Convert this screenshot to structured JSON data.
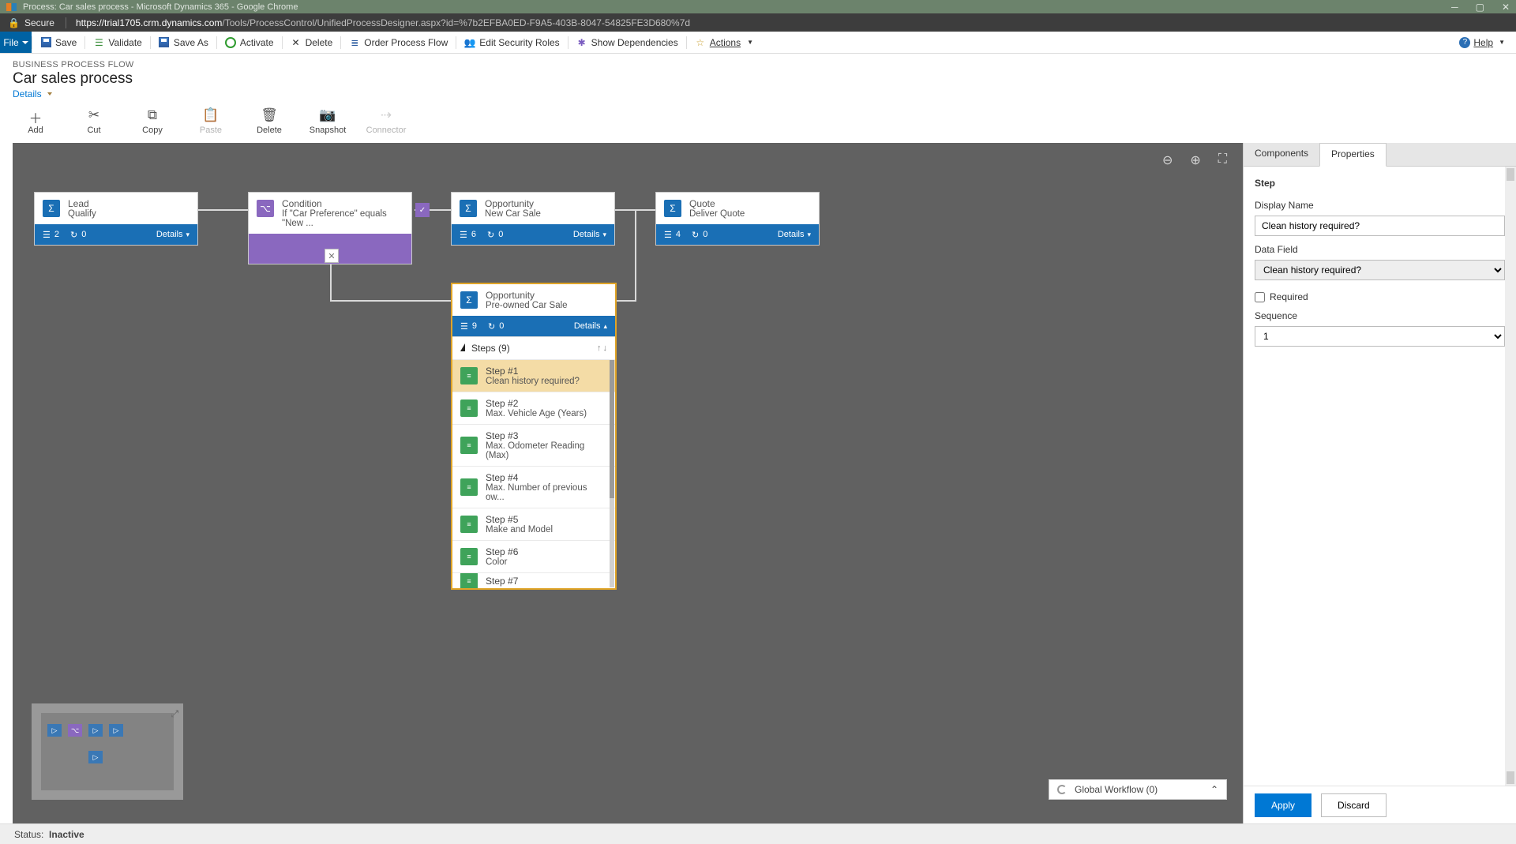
{
  "title_bar": "Process: Car sales process - Microsoft Dynamics 365 - Google Chrome",
  "url": {
    "secure": "Secure",
    "host": "https://trial1705.crm.dynamics.com",
    "path": "/Tools/ProcessControl/UnifiedProcessDesigner.aspx?id=%7b2EFBA0ED-F9A5-403B-8047-54825FE3D680%7d"
  },
  "cmd": {
    "file": "File",
    "save": "Save",
    "validate": "Validate",
    "saveas": "Save As",
    "activate": "Activate",
    "delete": "Delete",
    "order": "Order Process Flow",
    "editroles": "Edit Security Roles",
    "showdeps": "Show Dependencies",
    "actions": "Actions",
    "help": "Help"
  },
  "header": {
    "bpf": "BUSINESS PROCESS FLOW",
    "title": "Car sales process",
    "details": "Details"
  },
  "toolbar": {
    "add": "Add",
    "cut": "Cut",
    "copy": "Copy",
    "paste": "Paste",
    "delete": "Delete",
    "snapshot": "Snapshot",
    "connector": "Connector"
  },
  "nodes": {
    "lead": {
      "entity": "Lead",
      "stage": "Qualify",
      "count": "2",
      "cycle": "0",
      "details": "Details"
    },
    "cond": {
      "entity": "Condition",
      "stage": "If \"Car Preference\" equals \"New ..."
    },
    "opp1": {
      "entity": "Opportunity",
      "stage": "New Car Sale",
      "count": "6",
      "cycle": "0",
      "details": "Details"
    },
    "quote": {
      "entity": "Quote",
      "stage": "Deliver Quote",
      "count": "4",
      "cycle": "0",
      "details": "Details"
    },
    "opp2": {
      "entity": "Opportunity",
      "stage": "Pre-owned Car Sale",
      "count": "9",
      "cycle": "0",
      "details": "Details",
      "steps_header": "Steps (9)",
      "steps": [
        {
          "n": "Step #1",
          "d": "Clean history required?"
        },
        {
          "n": "Step #2",
          "d": "Max. Vehicle Age (Years)"
        },
        {
          "n": "Step #3",
          "d": "Max. Odometer Reading (Max)"
        },
        {
          "n": "Step #4",
          "d": "Max. Number of previous ow..."
        },
        {
          "n": "Step #5",
          "d": "Make and Model"
        },
        {
          "n": "Step #6",
          "d": "Color"
        },
        {
          "n": "Step #7",
          "d": ""
        }
      ]
    }
  },
  "global_workflow": "Global Workflow (0)",
  "panel": {
    "tabs": {
      "components": "Components",
      "properties": "Properties"
    },
    "section": "Step",
    "display_name_lbl": "Display Name",
    "display_name_val": "Clean history required?",
    "data_field_lbl": "Data Field",
    "data_field_val": "Clean history required?",
    "required_lbl": "Required",
    "sequence_lbl": "Sequence",
    "sequence_val": "1",
    "apply": "Apply",
    "discard": "Discard"
  },
  "status": {
    "lbl": "Status:",
    "val": "Inactive"
  }
}
